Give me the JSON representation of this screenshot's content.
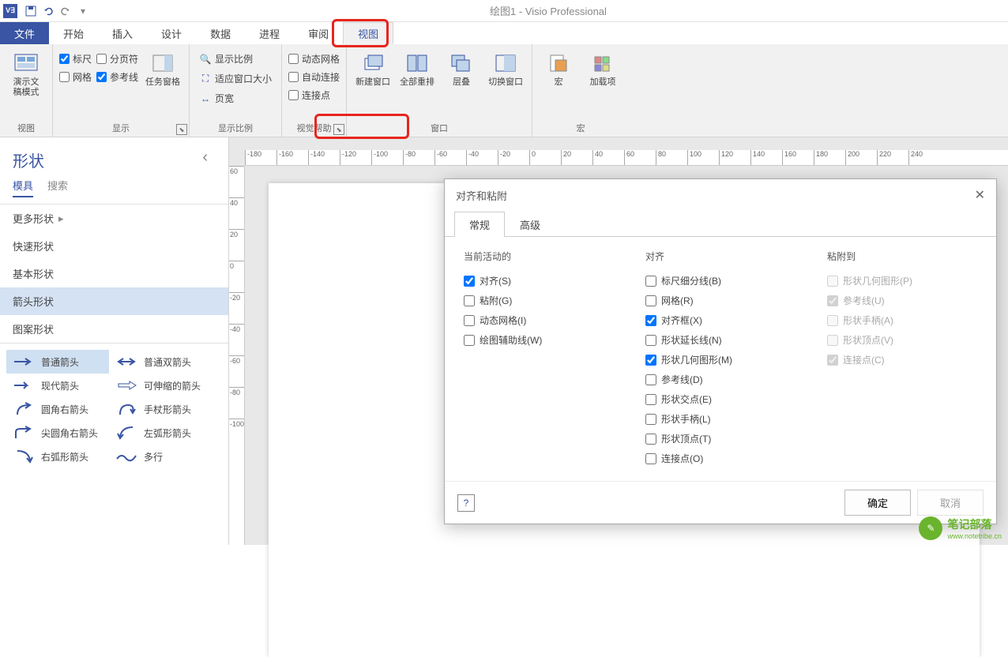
{
  "titlebar": {
    "title": "绘图1 - Visio Professional"
  },
  "tabs": {
    "file": "文件",
    "home": "开始",
    "insert": "插入",
    "design": "设计",
    "data": "数据",
    "process": "进程",
    "review": "审阅",
    "view": "视图"
  },
  "ribbon": {
    "view_group": "视图",
    "view_btn": "演示文\n稿模式",
    "show_group": "显示",
    "show": {
      "ruler": "标尺",
      "pagebreak": "分页符",
      "grid": "网格",
      "guides": "参考线",
      "taskpane": "任务窗格"
    },
    "zoom_group": "显示比例",
    "zoom": {
      "zoom": "显示比例",
      "fit": "适应窗口大小",
      "width": "页宽"
    },
    "visual_group": "视觉帮助",
    "visual": {
      "dyngrid": "动态网格",
      "autoconn": "自动连接",
      "connpt": "连接点"
    },
    "window_group": "窗口",
    "window": {
      "new": "新建窗口",
      "arrange": "全部重排",
      "cascade": "层叠",
      "switch": "切换窗口"
    },
    "macro_group": "宏",
    "macro": {
      "macro": "宏",
      "addin": "加载项"
    }
  },
  "shapes": {
    "title": "形状",
    "subtabs": {
      "stencils": "模具",
      "search": "搜索"
    },
    "cats": {
      "more": "更多形状",
      "quick": "快速形状",
      "basic": "基本形状",
      "arrow": "箭头形状",
      "pattern": "图案形状"
    },
    "items": {
      "a1": "普通箭头",
      "a2": "普通双箭头",
      "b1": "现代箭头",
      "b2": "可伸缩的箭头",
      "c1": "圆角右箭头",
      "c2": "手杖形箭头",
      "d1": "尖圆角右箭头",
      "d2": "左弧形箭头",
      "e1": "右弧形箭头",
      "e2": "多行"
    }
  },
  "ruler_h": [
    "-180",
    "-160",
    "-140",
    "-120",
    "-100",
    "-80",
    "-60",
    "-40",
    "-20",
    "0",
    "20",
    "40",
    "60",
    "80",
    "100",
    "120",
    "140",
    "160",
    "180",
    "200",
    "220",
    "240"
  ],
  "ruler_v": [
    "60",
    "40",
    "20",
    "0",
    "-20",
    "-40",
    "-60",
    "-80",
    "-100"
  ],
  "dialog": {
    "title": "对齐和粘附",
    "tabs": {
      "general": "常规",
      "advanced": "高级"
    },
    "col1_h": "当前活动的",
    "col1": {
      "snap": "对齐(S)",
      "glue": "粘附(G)",
      "dyngrid": "动态网格(I)",
      "drawaid": "绘图辅助线(W)"
    },
    "col2_h": "对齐",
    "col2": {
      "subdiv": "标尺细分线(B)",
      "grid": "网格(R)",
      "box": "对齐框(X)",
      "ext": "形状延长线(N)",
      "geom": "形状几何图形(M)",
      "guides": "参考线(D)",
      "inter": "形状交点(E)",
      "handles": "形状手柄(L)",
      "vertex": "形状顶点(T)",
      "connpt": "连接点(O)"
    },
    "col3_h": "粘附到",
    "col3": {
      "geom": "形状几何图形(P)",
      "guides": "参考线(U)",
      "handles": "形状手柄(A)",
      "vertex": "形状顶点(V)",
      "connpt": "连接点(C)"
    },
    "ok": "确定",
    "cancel": "取消"
  },
  "watermark": {
    "name": "笔记部落",
    "url": "www.notetribe.cn"
  }
}
